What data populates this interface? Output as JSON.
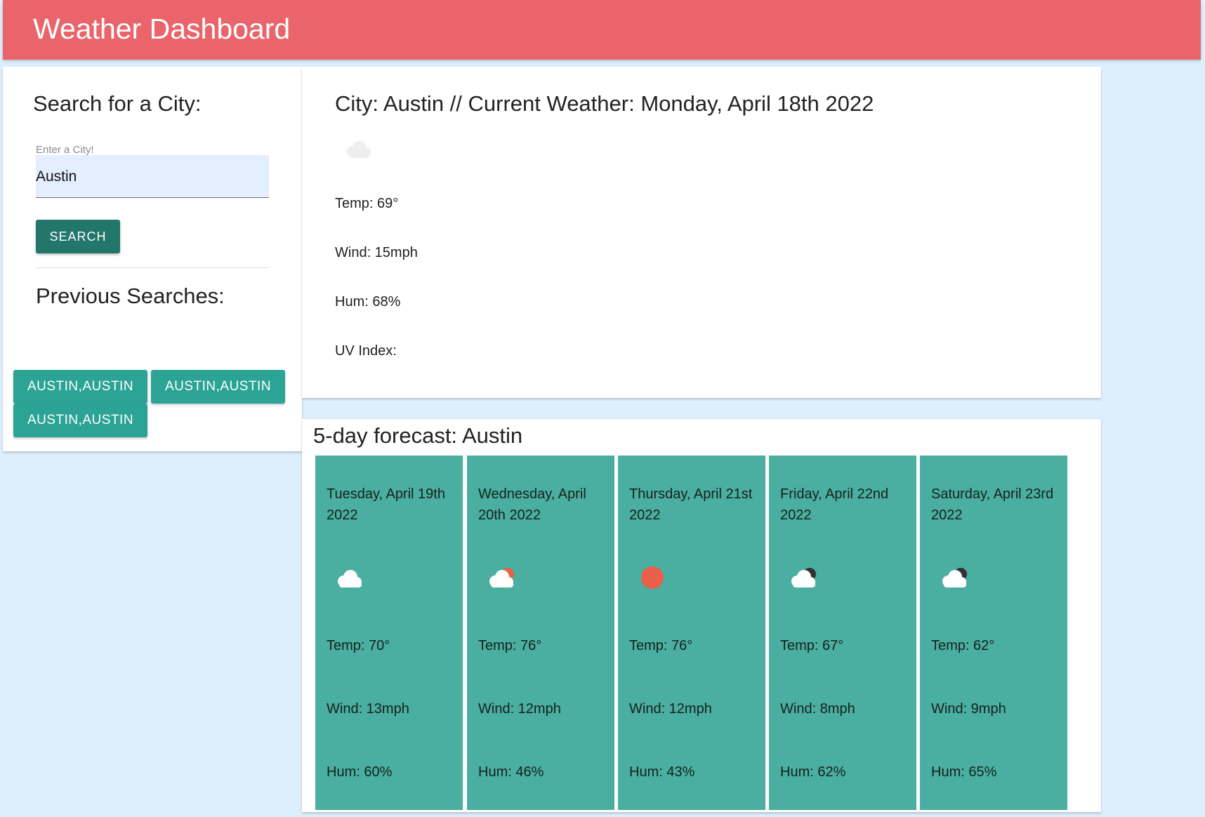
{
  "header": {
    "title": "Weather Dashboard",
    "color": "#ea646b"
  },
  "search": {
    "heading": "Search for a City:",
    "input_label": "Enter a City!",
    "input_value": "Austin",
    "button_label": "SEARCH",
    "previous_heading": "Previous Searches:",
    "history": [
      "AUSTIN,AUSTIN",
      "AUSTIN,AUSTIN",
      "AUSTIN,AUSTIN"
    ]
  },
  "current": {
    "title": "City: Austin // Current Weather: Monday, April 18th 2022",
    "icon": "cloud-icon",
    "temp": "Temp: 69°",
    "wind": "Wind: 15mph",
    "humidity": "Hum: 68%",
    "uv": "UV Index:"
  },
  "forecast": {
    "title": "5-day forecast: Austin",
    "card_color": "#4aaea0",
    "days": [
      {
        "date": "Tuesday, April 19th 2022",
        "icon": "cloud-icon",
        "temp": "Temp: 70°",
        "wind": "Wind: 13mph",
        "humidity": "Hum: 60%"
      },
      {
        "date": "Wednesday, April 20th 2022",
        "icon": "cloud-sun-icon",
        "temp": "Temp: 76°",
        "wind": "Wind: 12mph",
        "humidity": "Hum: 46%"
      },
      {
        "date": "Thursday, April 21st 2022",
        "icon": "sun-icon",
        "temp": "Temp: 76°",
        "wind": "Wind: 12mph",
        "humidity": "Hum: 43%"
      },
      {
        "date": "Friday, April 22nd 2022",
        "icon": "cloud-moon-icon",
        "temp": "Temp: 67°",
        "wind": "Wind: 8mph",
        "humidity": "Hum: 62%"
      },
      {
        "date": "Saturday, April 23rd 2022",
        "icon": "cloud-moon-icon",
        "temp": "Temp: 62°",
        "wind": "Wind: 9mph",
        "humidity": "Hum: 65%"
      }
    ]
  }
}
